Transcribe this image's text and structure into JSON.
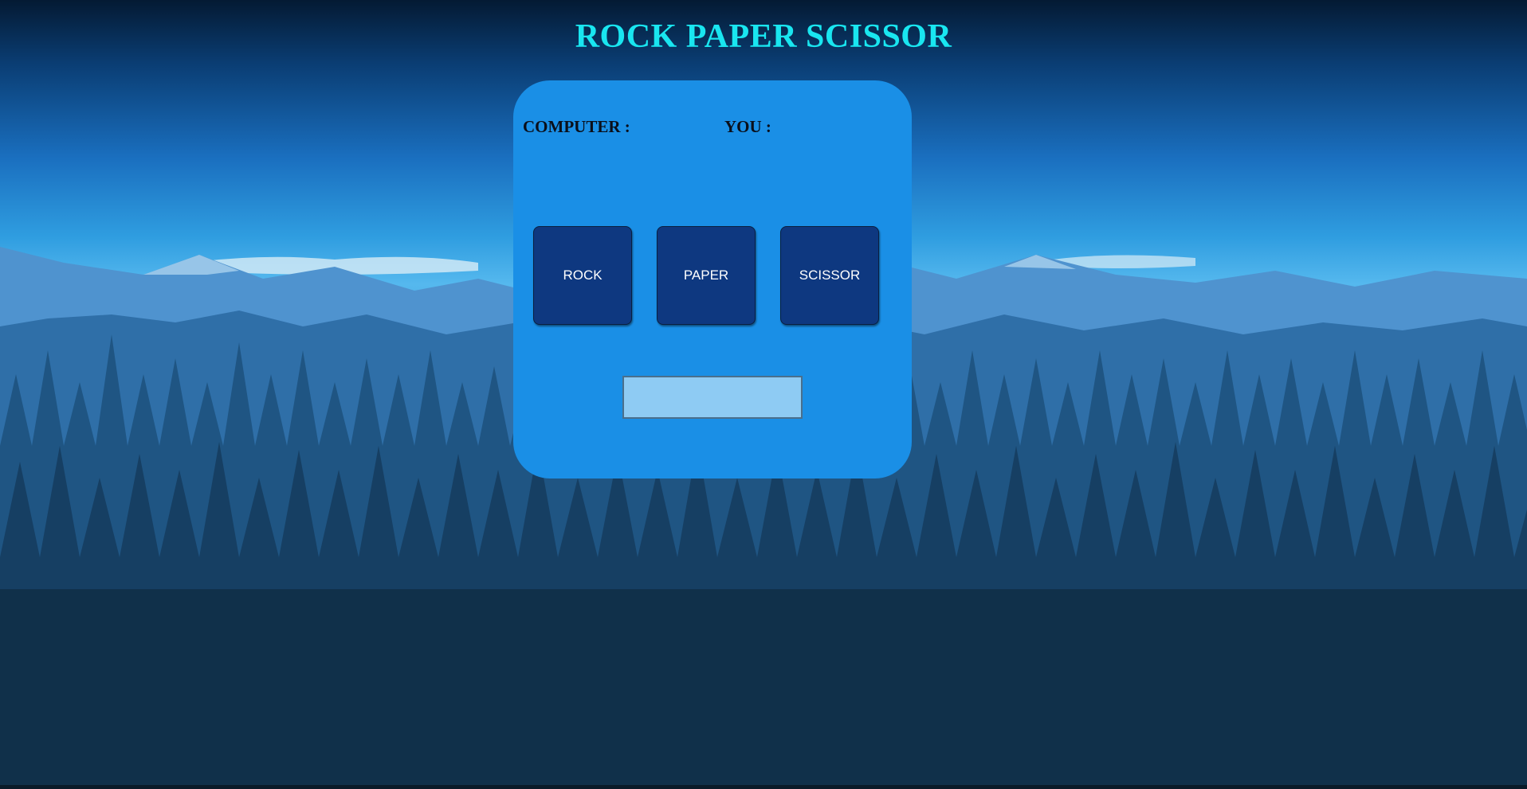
{
  "page": {
    "title": "ROCK PAPER SCISSOR"
  },
  "scoreboard": {
    "computer_label": "COMPUTER :",
    "computer_score": "",
    "you_label": "YOU :",
    "you_score": ""
  },
  "choices": {
    "rock_label": "ROCK",
    "paper_label": "PAPER",
    "scissor_label": "SCISSOR"
  },
  "result": {
    "text": ""
  },
  "colors": {
    "title": "#19e6f0",
    "panel": "#1a8fe6",
    "button": "#0e3880",
    "result_box": "#8ecbf3"
  },
  "background": {
    "description_icon": "mountain-forest-landscape"
  }
}
